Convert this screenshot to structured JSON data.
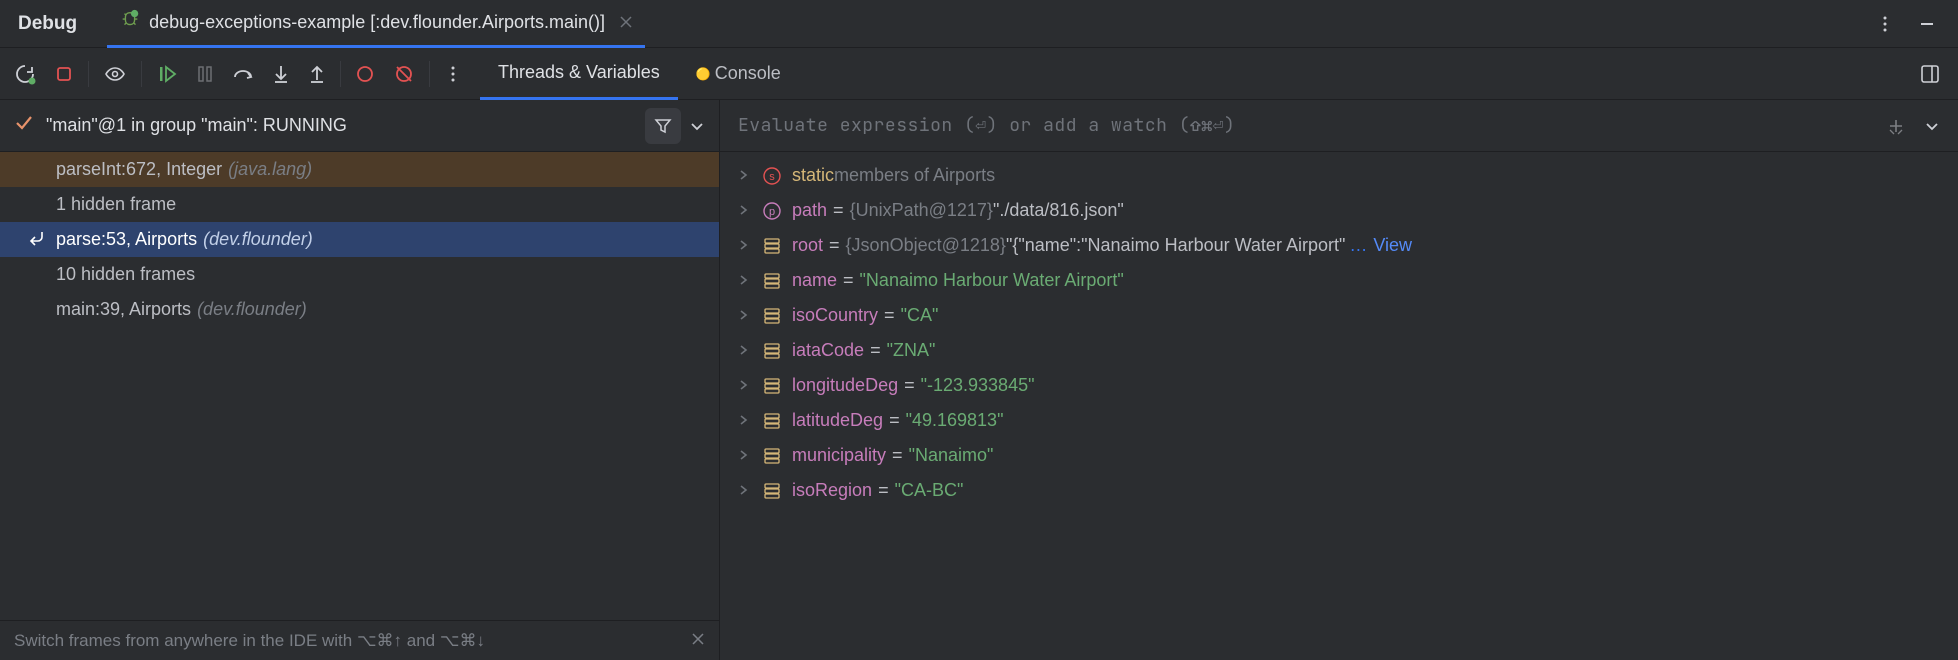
{
  "header": {
    "debug_title": "Debug",
    "tab_label": "debug-exceptions-example [:dev.flounder.Airports.main()]"
  },
  "sub_tabs": {
    "threads": "Threads & Variables",
    "console": "Console"
  },
  "left": {
    "thread_status": "\"main\"@1 in group \"main\": RUNNING",
    "frames": [
      {
        "text": "parseInt:672, Integer",
        "loc": "(java.lang)",
        "warn": true,
        "selected": false
      },
      {
        "text": "1 hidden frame",
        "loc": "",
        "warn": false,
        "selected": false
      },
      {
        "text": "parse:53, Airports",
        "loc": "(dev.flounder)",
        "warn": false,
        "selected": true
      },
      {
        "text": "10 hidden frames",
        "loc": "",
        "warn": false,
        "selected": false
      },
      {
        "text": "main:39, Airports",
        "loc": "(dev.flounder)",
        "warn": false,
        "selected": false
      }
    ],
    "hint": "Switch frames from anywhere in the IDE with ⌥⌘↑ and ⌥⌘↓"
  },
  "right": {
    "eval_placeholder": "Evaluate expression (⏎) or add a watch (⇧⌘⏎)",
    "vars": [
      {
        "kind": "static",
        "special": "static",
        "members": " members of Airports"
      },
      {
        "kind": "p",
        "name": "path",
        "obj": "{UnixPath@1217}",
        "val": "\"./data/816.json\""
      },
      {
        "kind": "f",
        "name": "root",
        "obj": "{JsonObject@1218}",
        "val": "\"{\"name\":\"Nanaimo Harbour Water Airport\"",
        "view": true
      },
      {
        "kind": "f",
        "name": "name",
        "obj": "",
        "val": "\"Nanaimo Harbour Water Airport\""
      },
      {
        "kind": "f",
        "name": "isoCountry",
        "obj": "",
        "val": "\"CA\""
      },
      {
        "kind": "f",
        "name": "iataCode",
        "obj": "",
        "val": "\"ZNA\""
      },
      {
        "kind": "f",
        "name": "longitudeDeg",
        "obj": "",
        "val": "\"-123.933845\""
      },
      {
        "kind": "f",
        "name": "latitudeDeg",
        "obj": "",
        "val": "\"49.169813\""
      },
      {
        "kind": "f",
        "name": "municipality",
        "obj": "",
        "val": "\"Nanaimo\""
      },
      {
        "kind": "f",
        "name": "isoRegion",
        "obj": "",
        "val": "\"CA-BC\""
      }
    ]
  },
  "view_label": "View",
  "ellipsis": "…"
}
